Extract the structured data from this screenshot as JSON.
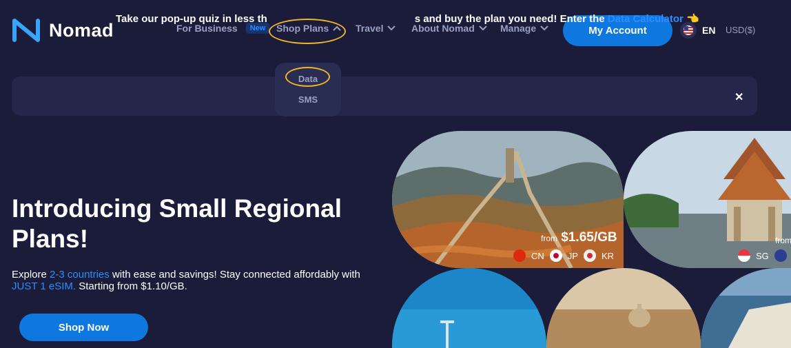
{
  "brand": {
    "name": "Nomad"
  },
  "nav": {
    "for_business": "For Business",
    "new_badge": "New",
    "shop_plans": "Shop Plans",
    "travel": "Travel",
    "about": "About Nomad",
    "manage": "Manage"
  },
  "account_button": "My Account",
  "language": "EN",
  "currency": "USD($)",
  "dropdown": {
    "items": [
      "Data",
      "SMS"
    ]
  },
  "banner": {
    "text_before": "Take our pop-up quiz in less th",
    "text_hidden_suffix": "s and buy the plan you need! Enter the ",
    "link": "Data Calculator",
    "emoji": "👈",
    "close": "✕"
  },
  "hero": {
    "title": "Introducing Small Regional Plans!",
    "sub_pre": "Explore ",
    "sub_link1": "2-3 countries",
    "sub_mid": " with ease and savings! Stay connected affordably with ",
    "sub_link2": "JUST 1 eSIM.",
    "sub_post": " Starting from $1.10/GB.",
    "cta": "Shop Now"
  },
  "cards": [
    {
      "name": "great-wall",
      "price_from": "from",
      "price": "$1.65/GB",
      "countries": [
        "CN",
        "JP",
        "KR"
      ]
    },
    {
      "name": "thai-temple",
      "price_from": "from",
      "countries": [
        "SG"
      ]
    }
  ],
  "colors": {
    "background": "#1a1c3a",
    "accent": "#0f78e0",
    "link": "#2e8dff",
    "highlight": "#f2b52a"
  }
}
